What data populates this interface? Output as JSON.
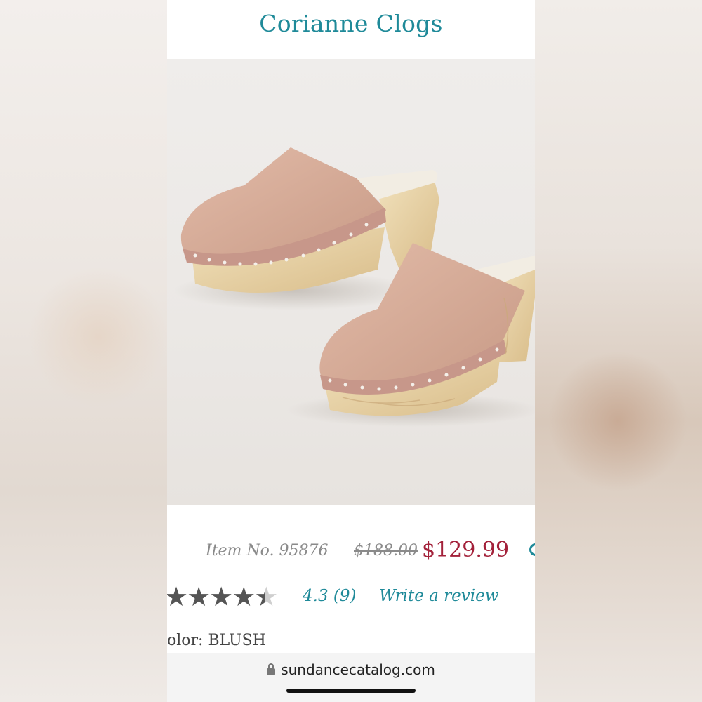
{
  "product": {
    "title": "Corianne Clogs",
    "item_number": "Item No. 95876",
    "original_price": "$188.00",
    "sale_price": "$129.99",
    "color_label": "olor: BLUSH"
  },
  "reviews": {
    "rating_text": "4.3 (9)",
    "write_review_label": "Write a review",
    "stars_filled": 4.3,
    "stars_total": 5
  },
  "browser": {
    "url": "sundancecatalog.com"
  },
  "colors": {
    "title": "#1f8a99",
    "sale_price": "#a3213a",
    "link": "#1f8a99",
    "clog_leather": "#d7ad9b",
    "clog_wood": "#e8d3a8"
  },
  "icons": [
    "lock-icon",
    "star-icon"
  ]
}
